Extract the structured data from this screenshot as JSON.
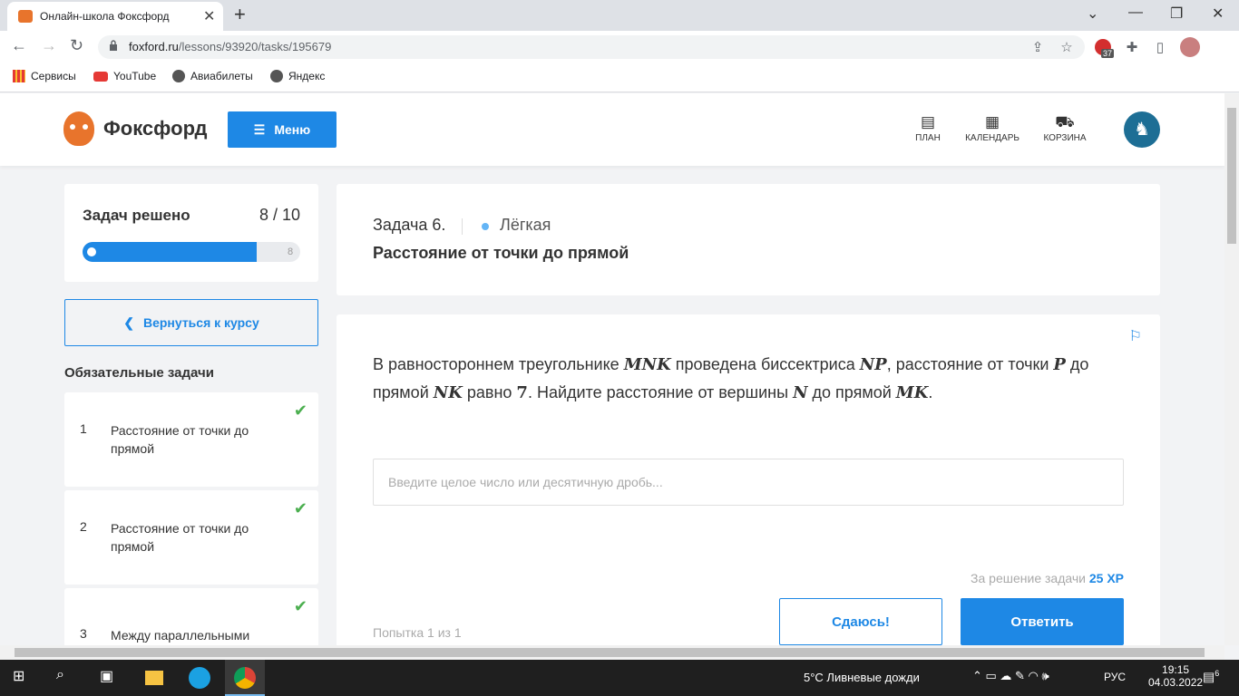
{
  "browser": {
    "tab_title": "Онлайн-школа Фоксфорд",
    "url_host": "foxford.ru",
    "url_path": "/lessons/93920/tasks/195679",
    "ext_badge": "37",
    "bookmarks": [
      "Сервисы",
      "YouTube",
      "Авиабилеты",
      "Яндекс"
    ]
  },
  "site": {
    "brand": "Фоксфорд",
    "menu_label": "Меню",
    "nav": {
      "plan": "ПЛАН",
      "calendar": "КАЛЕНДАРЬ",
      "cart": "КОРЗИНА"
    }
  },
  "progress": {
    "label": "Задач решено",
    "count": "8 / 10",
    "solved": 8,
    "total": 10,
    "end_badge": "8"
  },
  "back_label": "Вернуться к курсу",
  "required_title": "Обязательные задачи",
  "tasks": [
    {
      "num": "1",
      "title": "Расстояние от точки до прямой"
    },
    {
      "num": "2",
      "title": "Расстояние от точки до прямой"
    },
    {
      "num": "3",
      "title": "Между параллельными"
    }
  ],
  "task": {
    "number": "Задача 6.",
    "difficulty": "Лёгкая",
    "title": "Расстояние от точки до прямой",
    "cond": [
      "В равностороннем треугольнике ",
      "MNK",
      " проведена биссектриса ",
      "NP",
      ", расстояние от точки ",
      "P",
      " до прямой ",
      "NK",
      " равно ",
      "7",
      ". Найдите расстояние от вершины ",
      "N",
      " до прямой ",
      "MK",
      "."
    ],
    "placeholder": "Введите целое число или десятичную дробь...",
    "reward_prefix": "За решение задачи",
    "reward_value": "25 XP",
    "attempt": "Попытка 1 из 1",
    "give_up": "Сдаюсь!",
    "submit": "Ответить"
  },
  "taskbar": {
    "weather": "5°C  Ливневые дожди",
    "lang": "РУС",
    "time": "19:15",
    "date": "04.03.2022",
    "notif": "6"
  },
  "colors": {
    "accent": "#1e88e5",
    "check": "#4caf50",
    "brand_orange": "#e8742c"
  }
}
